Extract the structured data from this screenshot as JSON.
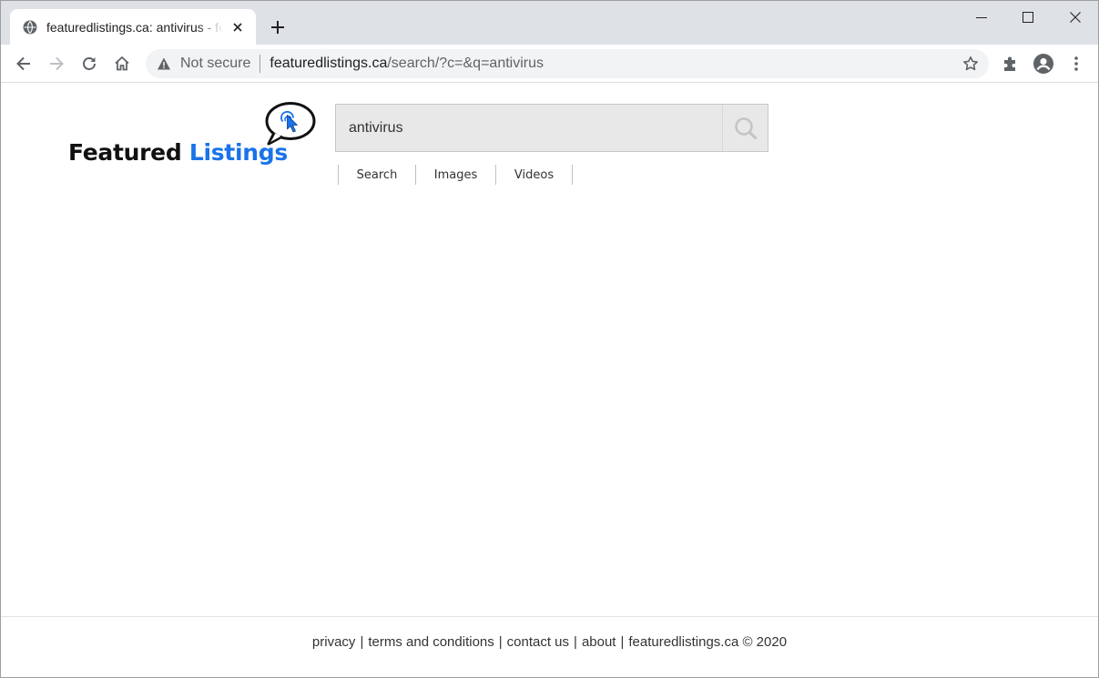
{
  "tab": {
    "title": "featuredlistings.ca: antivirus - featuredlistings.ca",
    "favicon": "globe-icon"
  },
  "toolbar": {
    "security_label": "Not secure",
    "url_host": "featuredlistings.ca",
    "url_path": "/search/?c=&q=antivirus"
  },
  "logo": {
    "word1": "Featured",
    "word2": "Listings",
    "word1_color": "#111111",
    "word2_color": "#1a73e8"
  },
  "search": {
    "query": "antivirus",
    "tabs": [
      "Search",
      "Images",
      "Videos"
    ]
  },
  "footer": {
    "privacy": "privacy",
    "terms": "terms and conditions",
    "contact": "contact us",
    "about": "about",
    "copyright": "featuredlistings.ca © 2020",
    "separator": "|"
  }
}
